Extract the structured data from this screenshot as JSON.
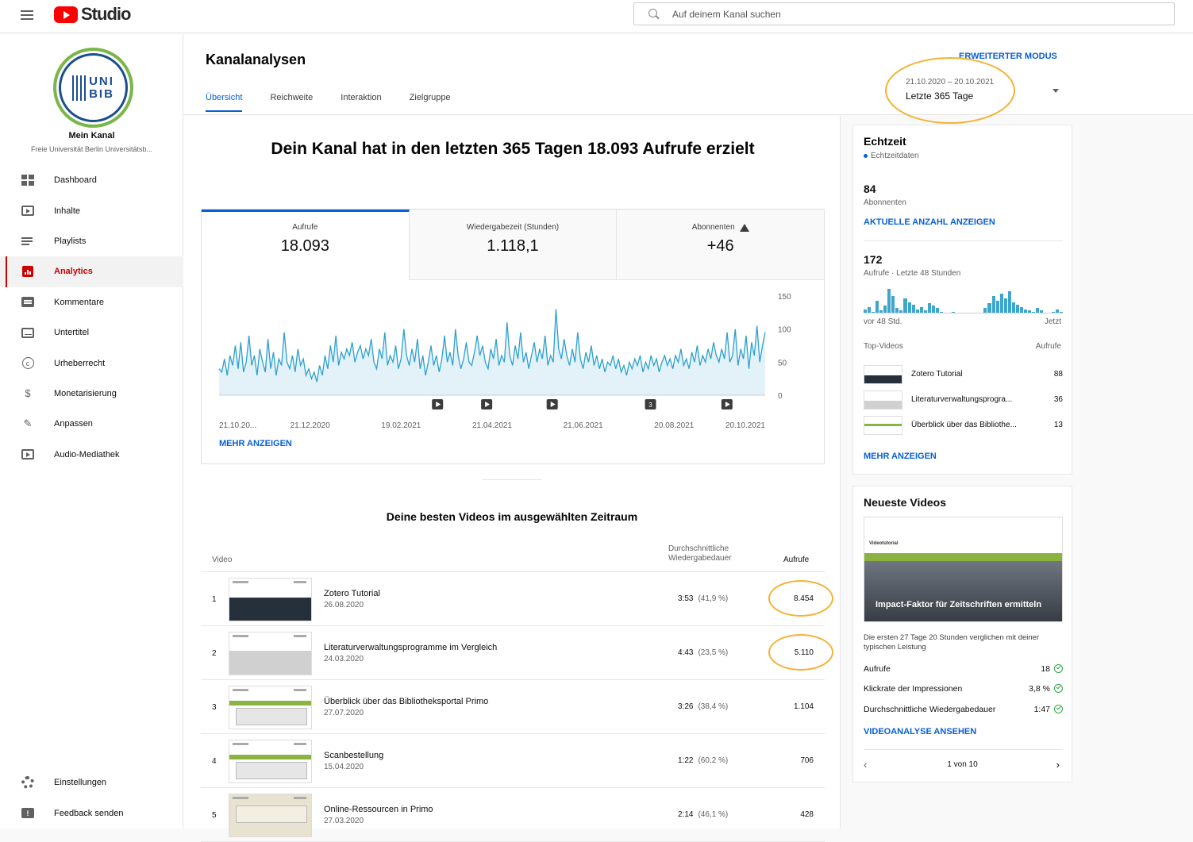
{
  "header": {
    "logo_text": "Studio",
    "search_placeholder": "Auf deinem Kanal suchen"
  },
  "sidebar": {
    "channel_name": "Mein Kanal",
    "channel_sub": "Freie Universität Berlin Universitätsb...",
    "avatar_text_1": "UNI",
    "avatar_text_2": "BIB",
    "items": [
      {
        "label": "Dashboard",
        "icon": "dashboard-icon"
      },
      {
        "label": "Inhalte",
        "icon": "content-icon"
      },
      {
        "label": "Playlists",
        "icon": "playlist-icon"
      },
      {
        "label": "Analytics",
        "icon": "analytics-icon",
        "active": true
      },
      {
        "label": "Kommentare",
        "icon": "comments-icon"
      },
      {
        "label": "Untertitel",
        "icon": "subtitles-icon"
      },
      {
        "label": "Urheberrecht",
        "icon": "copyright-icon"
      },
      {
        "label": "Monetarisierung",
        "icon": "dollar-icon"
      },
      {
        "label": "Anpassen",
        "icon": "customize-icon"
      },
      {
        "label": "Audio-Mediathek",
        "icon": "audio-library-icon"
      }
    ],
    "bottom_items": [
      {
        "label": "Einstellungen",
        "icon": "gear-icon"
      },
      {
        "label": "Feedback senden",
        "icon": "feedback-icon"
      }
    ]
  },
  "main": {
    "title": "Kanalanalysen",
    "tabs": [
      "Übersicht",
      "Reichweite",
      "Interaktion",
      "Zielgruppe"
    ],
    "advanced_mode": "ERWEITERTER MODUS",
    "date_range": "21.10.2020 – 20.10.2021",
    "date_label": "Letzte 365 Tage",
    "headline": "Dein Kanal hat in den letzten 365 Tagen 18.093 Aufrufe erzielt",
    "metrics": [
      {
        "label": "Aufrufe",
        "value": "18.093"
      },
      {
        "label": "Wiedergabezeit (Stunden)",
        "value": "1.118,1"
      },
      {
        "label": "Abonnenten",
        "value": "+46"
      }
    ],
    "more_link": "MEHR ANZEIGEN",
    "top_videos_title": "Deine besten Videos im ausgewählten Zeitraum",
    "table_headers": {
      "video": "Video",
      "avg_duration_1": "Durchschnittliche",
      "avg_duration_2": "Wiedergabedauer",
      "views": "Aufrufe"
    },
    "videos": [
      {
        "rank": "1",
        "title": "Zotero Tutorial",
        "date": "26.08.2020",
        "duration": "3:53",
        "pct": "(41,9 %)",
        "views": "8.454"
      },
      {
        "rank": "2",
        "title": "Literaturverwaltungsprogramme im Vergleich",
        "date": "24.03.2020",
        "duration": "4:43",
        "pct": "(23,5 %)",
        "views": "5.110"
      },
      {
        "rank": "3",
        "title": "Überblick über das Bibliotheksportal Primo",
        "date": "27.07.2020",
        "duration": "3:26",
        "pct": "(38,4 %)",
        "views": "1.104"
      },
      {
        "rank": "4",
        "title": "Scanbestellung",
        "date": "15.04.2020",
        "duration": "1:22",
        "pct": "(60,2 %)",
        "views": "706"
      },
      {
        "rank": "5",
        "title": "Online-Ressourcen in Primo",
        "date": "27.03.2020",
        "duration": "2:14",
        "pct": "(46,1 %)",
        "views": "428"
      }
    ]
  },
  "chart_data": {
    "type": "line",
    "x_tick_labels": [
      "21.10.20...",
      "21.12.2020",
      "19.02.2021",
      "21.04.2021",
      "21.06.2021",
      "20.08.2021",
      "20.10.2021"
    ],
    "y_ticks": [
      0,
      50,
      100,
      150
    ],
    "ylim": [
      0,
      150
    ],
    "series": [
      {
        "values": [
          40,
          35,
          55,
          30,
          60,
          45,
          75,
          40,
          80,
          35,
          50,
          90,
          45,
          60,
          30,
          70,
          50,
          35,
          85,
          40,
          65,
          30,
          55,
          45,
          95,
          50,
          40,
          60,
          35,
          70,
          45,
          55,
          30,
          40,
          25,
          35,
          20,
          45,
          30,
          60,
          40,
          75,
          50,
          90,
          45,
          65,
          55,
          70,
          60,
          80,
          50,
          65,
          75,
          55,
          70,
          60,
          85,
          50,
          40,
          70,
          55,
          95,
          45,
          60,
          50,
          75,
          40,
          55,
          100,
          60,
          45,
          70,
          50,
          85,
          40,
          60,
          30,
          50,
          75,
          45,
          60,
          35,
          55,
          90,
          50,
          65,
          45,
          100,
          60,
          40,
          55,
          80,
          50,
          45,
          65,
          90,
          60,
          75,
          50,
          40,
          70,
          55,
          85,
          45,
          60,
          50,
          110,
          60,
          45,
          75,
          55,
          95,
          50,
          65,
          40,
          60,
          80,
          50,
          70,
          55,
          90,
          45,
          60,
          50,
          130,
          70,
          55,
          85,
          60,
          45,
          70,
          50,
          95,
          55,
          40,
          65,
          50,
          75,
          45,
          60,
          40,
          55,
          35,
          50,
          45,
          60,
          40,
          55,
          35,
          45,
          30,
          50,
          40,
          55,
          45,
          60,
          35,
          50,
          40,
          60,
          45,
          55,
          35,
          50,
          60,
          45,
          55,
          40,
          60,
          50,
          70,
          45,
          55,
          40,
          65,
          50,
          75,
          45,
          60,
          50,
          70,
          55,
          80,
          60,
          50,
          70,
          55,
          95,
          50,
          60,
          100,
          45,
          70,
          55,
          90,
          40,
          80,
          60,
          105,
          50,
          75,
          95
        ]
      }
    ],
    "markers": [
      "play",
      "play",
      "play",
      "3",
      "play"
    ]
  },
  "realtime": {
    "title": "Echtzeit",
    "subtitle": "Echtzeitdaten",
    "subs_value": "84",
    "subs_label": "Abonnenten",
    "subs_link": "AKTUELLE ANZAHL ANZEIGEN",
    "views_value": "172",
    "views_label": "Aufrufe · Letzte 48 Stunden",
    "axis_left": "vor 48 Std.",
    "axis_right": "Jetzt",
    "top_label": "Top-Videos",
    "top_col": "Aufrufe",
    "bars": [
      3,
      5,
      1,
      10,
      2,
      6,
      20,
      14,
      4,
      2,
      12,
      9,
      7,
      3,
      5,
      2,
      8,
      6,
      4,
      1,
      0,
      0,
      1,
      0,
      0,
      0,
      0,
      0,
      0,
      0,
      4,
      8,
      14,
      10,
      16,
      12,
      18,
      9,
      7,
      5,
      3,
      2,
      1,
      4,
      2,
      0,
      0,
      1,
      3,
      1
    ],
    "top_videos": [
      {
        "title": "Zotero Tutorial",
        "views": "88"
      },
      {
        "title": "Literaturverwaltungsprogra...",
        "views": "36"
      },
      {
        "title": "Überblick über das Bibliothe...",
        "views": "13"
      }
    ],
    "more_link": "MEHR ANZEIGEN"
  },
  "newest": {
    "title": "Neueste Videos",
    "thumb_caption": "Impact-Faktor für Zeitschriften ermitteln",
    "thumb_tag": "Videotutorial",
    "perf_text": "Die ersten 27 Tage 20 Stunden verglichen mit deiner typischen Leistung",
    "stats": [
      {
        "label": "Aufrufe",
        "value": "18"
      },
      {
        "label": "Klickrate der Impressionen",
        "value": "3,8 %"
      },
      {
        "label": "Durchschnittliche Wiedergabedauer",
        "value": "1:47"
      }
    ],
    "link": "VIDEOANALYSE ANSEHEN",
    "pager": "1 von 10"
  }
}
